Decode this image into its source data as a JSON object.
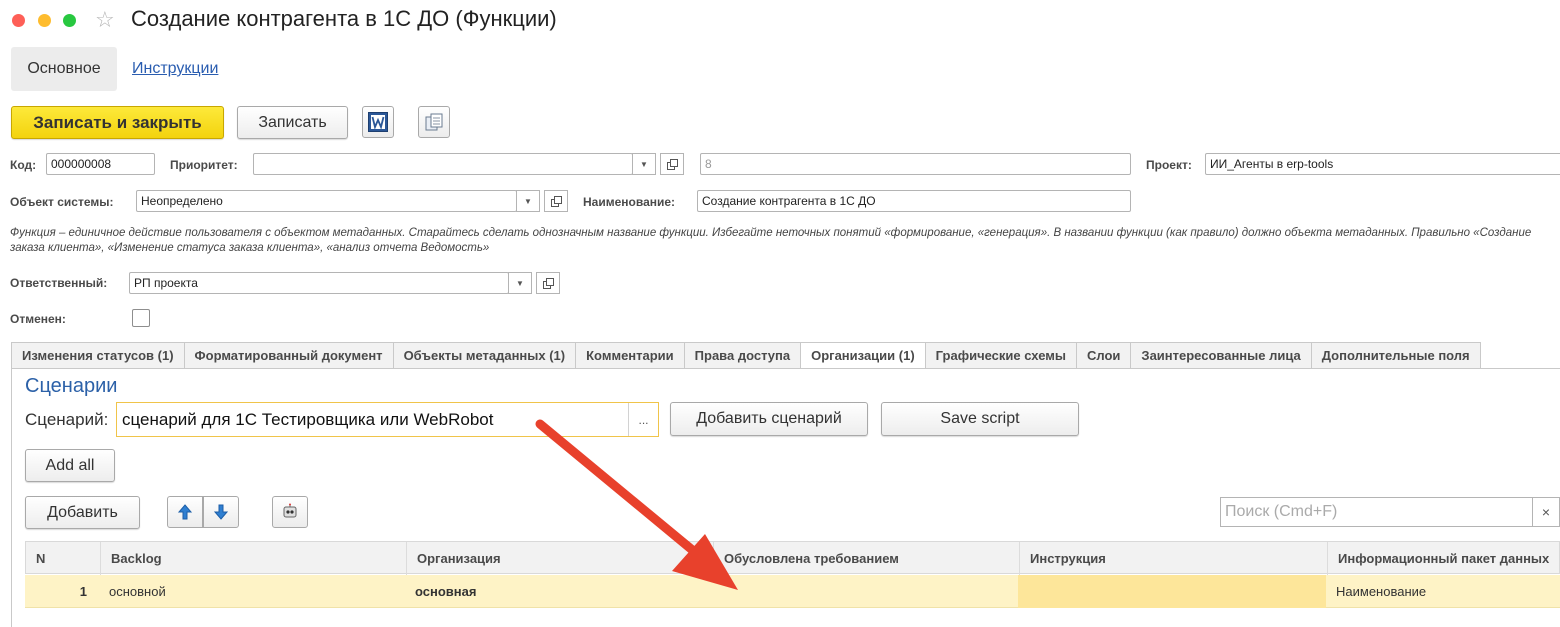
{
  "window": {
    "title": "Создание контрагента в 1С ДО (Функции)",
    "dot_colors": [
      "#fe5f57",
      "#febc2e",
      "#28c840"
    ]
  },
  "top_tabs": {
    "main": "Основное",
    "instructions": "Инструкции"
  },
  "toolbar": {
    "save_close": "Записать и закрыть",
    "save": "Записать"
  },
  "form": {
    "code_label": "Код:",
    "code_value": "000000008",
    "priority_label": "Приоритет:",
    "priority_value": "",
    "priority_number": "8",
    "project_label": "Проект:",
    "project_value": "ИИ_Агенты в erp-tools",
    "object_label": "Объект системы:",
    "object_value": "Неопределено",
    "name_label": "Наименование:",
    "name_value": "Создание контрагента в 1С ДО",
    "hint": "Функция – единичное действие пользователя с объектом метаданных. Старайтесь сделать однозначным название функции. Избегайте неточных понятий «формирование, «генерация». В названии функции (как правило) должно объекта метаданных. Правильно «Создание заказа клиента», «Изменение статуса заказа клиента», «анализ отчета Ведомость»",
    "responsible_label": "Ответственный:",
    "responsible_value": "РП проекта",
    "cancelled_label": "Отменен:"
  },
  "tabs": [
    "Изменения статусов (1)",
    "Форматированный документ",
    "Объекты метаданных (1)",
    "Комментарии",
    "Права доступа",
    "Организации (1)",
    "Графические схемы",
    "Слои",
    "Заинтересованные лица",
    "Дополнительные поля"
  ],
  "scenarios": {
    "title": "Сценарии",
    "label": "Сценарий:",
    "value": "сценарий для 1С Тестировщика или WebRobot",
    "dots": "...",
    "add_button": "Добавить сценарий",
    "save_button": "Save script",
    "add_all_button": "Add all"
  },
  "list": {
    "add_button": "Добавить",
    "search_placeholder": "Поиск (Cmd+F)",
    "search_clear": "×",
    "columns": [
      "N",
      "Backlog",
      "Организация",
      "Обусловлена требованием",
      "Инструкция",
      "Информационный пакет данных"
    ],
    "rows": [
      {
        "n": "1",
        "backlog": "основной",
        "org": "основная",
        "req": "",
        "instr": "",
        "pack": "Наименование"
      }
    ]
  },
  "colors": {
    "accent_yellow": "#f3d30e",
    "link_blue": "#2a5db0",
    "arrow_red": "#e8412c",
    "row_highlight": "#fef3c6"
  }
}
